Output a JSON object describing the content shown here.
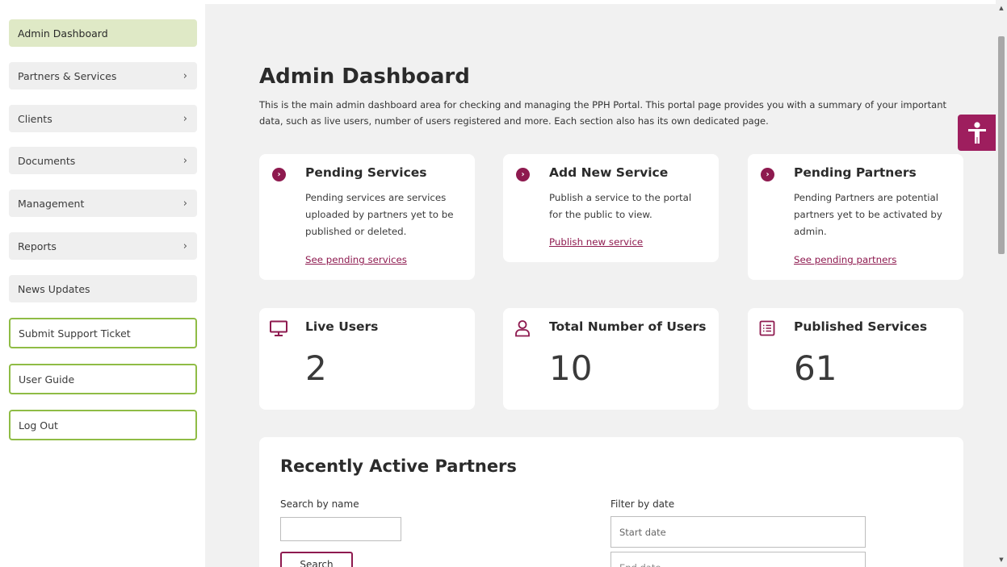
{
  "sidebar": {
    "items": [
      {
        "label": "Admin Dashboard"
      },
      {
        "label": "Partners & Services",
        "chevron": "›"
      },
      {
        "label": "Clients",
        "chevron": "›"
      },
      {
        "label": "Documents",
        "chevron": "›"
      },
      {
        "label": "Management",
        "chevron": "›"
      },
      {
        "label": "Reports",
        "chevron": "›"
      },
      {
        "label": "News Updates"
      },
      {
        "label": "Submit Support Ticket"
      },
      {
        "label": "User Guide"
      },
      {
        "label": "Log Out"
      }
    ]
  },
  "main": {
    "title": "Admin Dashboard",
    "description": "This is the main admin dashboard area for checking and managing the PPH Portal. This portal page provides you with a summary of your important data, such as live users, number of users registered and more. Each section also has its own dedicated page."
  },
  "action_cards": [
    {
      "title": "Pending Services",
      "text": "Pending services are services uploaded by partners yet to be published or deleted.",
      "link": "See pending services"
    },
    {
      "title": "Add New Service",
      "text": "Publish a service to the portal for the public to view.",
      "link": "Publish new service"
    },
    {
      "title": "Pending Partners",
      "text": "Pending Partners are potential partners yet to be activated by admin.",
      "link": "See pending partners"
    }
  ],
  "stat_cards": [
    {
      "title": "Live Users",
      "value": "2",
      "icon": "monitor-icon"
    },
    {
      "title": "Total Number of Users",
      "value": "10",
      "icon": "user-icon"
    },
    {
      "title": "Published Services",
      "value": "61",
      "icon": "list-icon"
    }
  ],
  "partners": {
    "title": "Recently Active Partners",
    "search_label": "Search by name",
    "search_button": "Search",
    "filter_label": "Filter by date",
    "start_date_placeholder": "Start date",
    "end_date_placeholder": "End date"
  },
  "colors": {
    "accent": "#8e1a4f",
    "accessibility_button": "#9e1e5e",
    "sidebar_active": "#dfe9c6",
    "sidebar_outline": "#8fbc45"
  }
}
